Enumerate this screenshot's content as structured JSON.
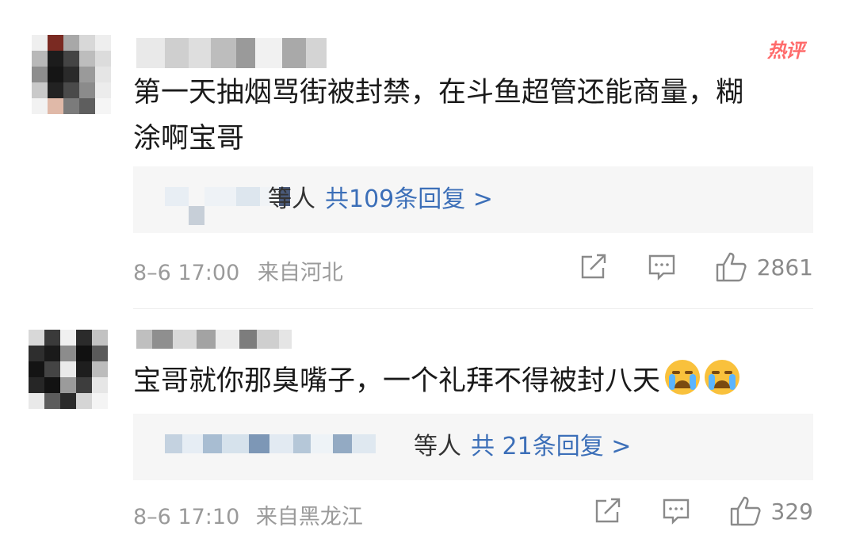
{
  "comments": [
    {
      "hot_label": "热评",
      "text_line1": "第一天抽烟骂街被封禁，在斗鱼超管还能商量，糊",
      "text_line2": "涂啊宝哥",
      "reply_suffix": "等人",
      "reply_count": "共109条回复 >",
      "time": "8–6 17:00",
      "location": "来自河北",
      "like_count": "2861"
    },
    {
      "text_line1": "宝哥就你那臭嘴子，一个礼拜不得被封八天",
      "reply_suffix": "等人",
      "reply_count": "共 21条回复 >",
      "time": "8–6 17:10",
      "location": "来自黑龙江",
      "like_count": "329"
    }
  ],
  "icons": {
    "share": "share-icon",
    "comment": "comment-icon",
    "like": "thumbs-up-icon",
    "emoji": "crying-face-emoji"
  },
  "colors": {
    "hot": "#ff6b6b",
    "link": "#3c6fb8",
    "meta": "#9a9a9a"
  }
}
